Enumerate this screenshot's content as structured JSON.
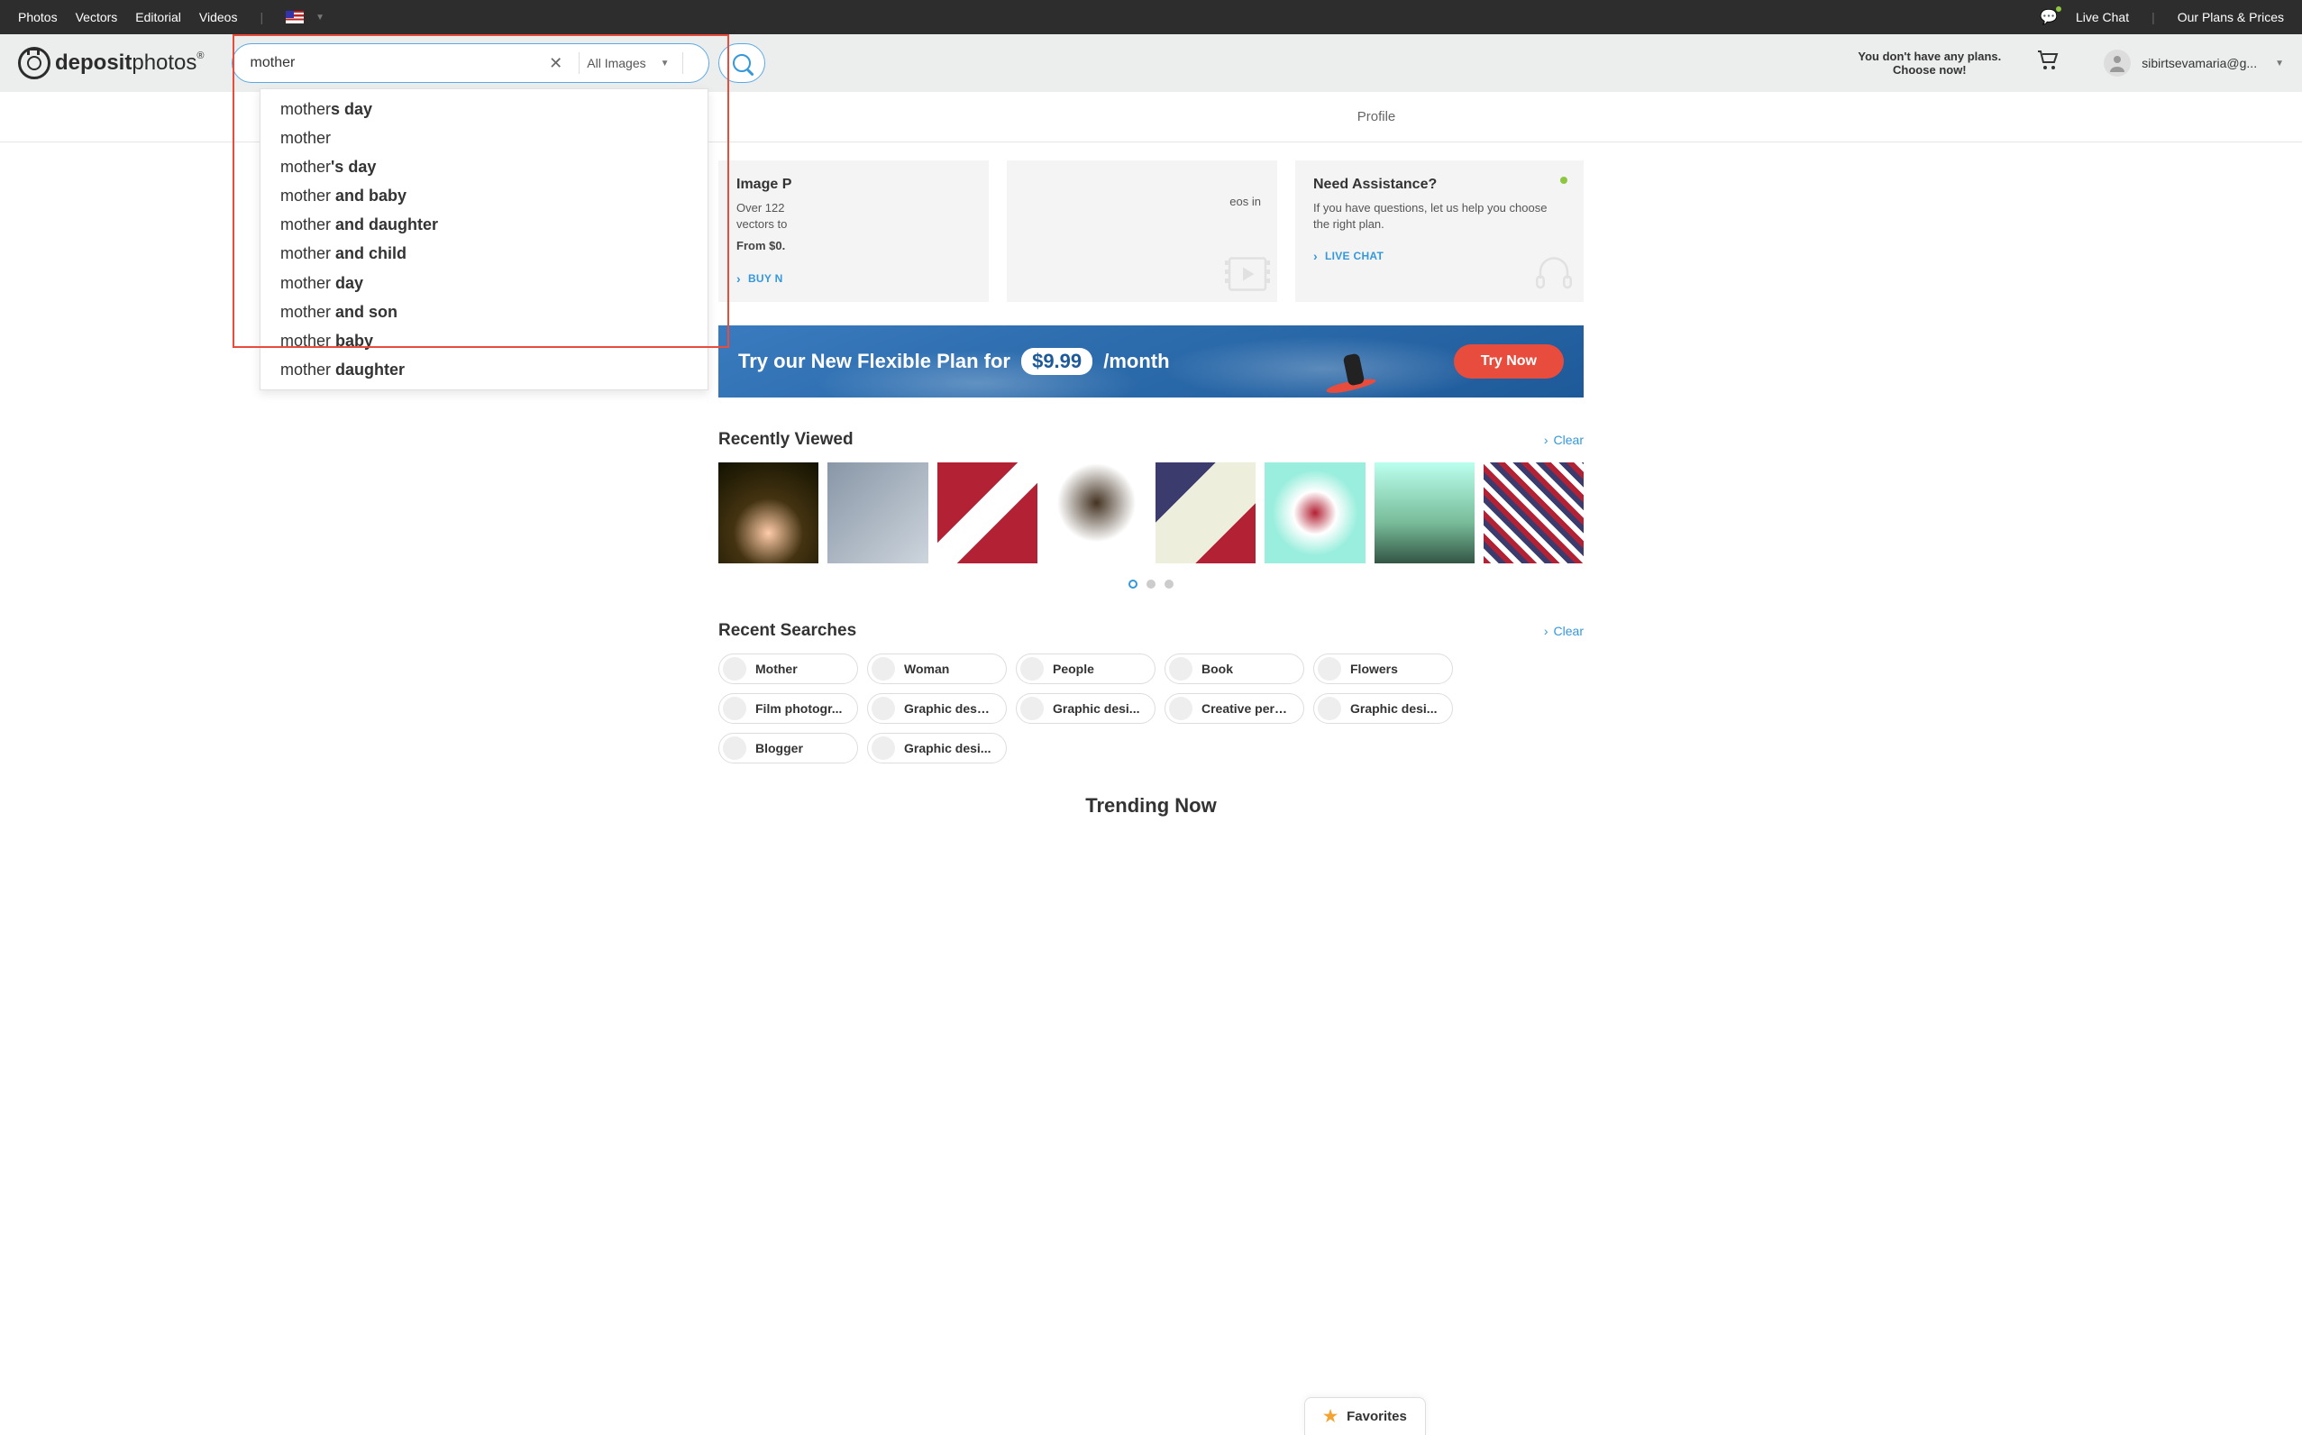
{
  "topbar": {
    "links": [
      "Photos",
      "Vectors",
      "Editorial",
      "Videos"
    ],
    "live_chat": "Live Chat",
    "plans": "Our Plans & Prices"
  },
  "header": {
    "logo_text_bold": "deposit",
    "logo_text_rest": "photos",
    "logo_reg": "®",
    "search_value": "mother",
    "type_selector": "All Images",
    "plans_line1": "You don't have any plans.",
    "plans_line2": "Choose now!",
    "username": "sibirtsevamaria@g..."
  },
  "subnav": {
    "profile": "Profile"
  },
  "suggestions": [
    {
      "pre": "mother",
      "bold": "s day"
    },
    {
      "pre": "mother",
      "bold": ""
    },
    {
      "pre": "mother",
      "bold": "'s day"
    },
    {
      "pre": "mother ",
      "bold": "and baby"
    },
    {
      "pre": "mother ",
      "bold": "and daughter"
    },
    {
      "pre": "mother ",
      "bold": "and child"
    },
    {
      "pre": "mother ",
      "bold": "day"
    },
    {
      "pre": "mother ",
      "bold": "and son"
    },
    {
      "pre": "mother ",
      "bold": "baby"
    },
    {
      "pre": "mother ",
      "bold": "daughter"
    }
  ],
  "cards": {
    "left": {
      "title": "Image P",
      "desc": "Over 122",
      "desc2": "vectors to",
      "from": "From $0.",
      "cta": "BUY N"
    },
    "mid_fragment": "eos in",
    "right": {
      "title": "Need Assistance?",
      "desc": "If you have questions, let us help you choose the right plan.",
      "cta": "LIVE CHAT"
    }
  },
  "promo": {
    "text_pre": "Try our New Flexible Plan for ",
    "price": "$9.99",
    "text_post": " /month",
    "cta": "Try Now"
  },
  "recently_viewed": {
    "title": "Recently Viewed",
    "clear": "Clear"
  },
  "recent_searches": {
    "title": "Recent Searches",
    "clear": "Clear",
    "chips": [
      "Mother",
      "Woman",
      "People",
      "Book",
      "Flowers",
      "Film photogr...",
      "Graphic design",
      "Graphic desi...",
      "Creative person",
      "Graphic desi...",
      "Blogger",
      "Graphic desi..."
    ]
  },
  "favorites": "Favorites",
  "trending": "Trending Now"
}
